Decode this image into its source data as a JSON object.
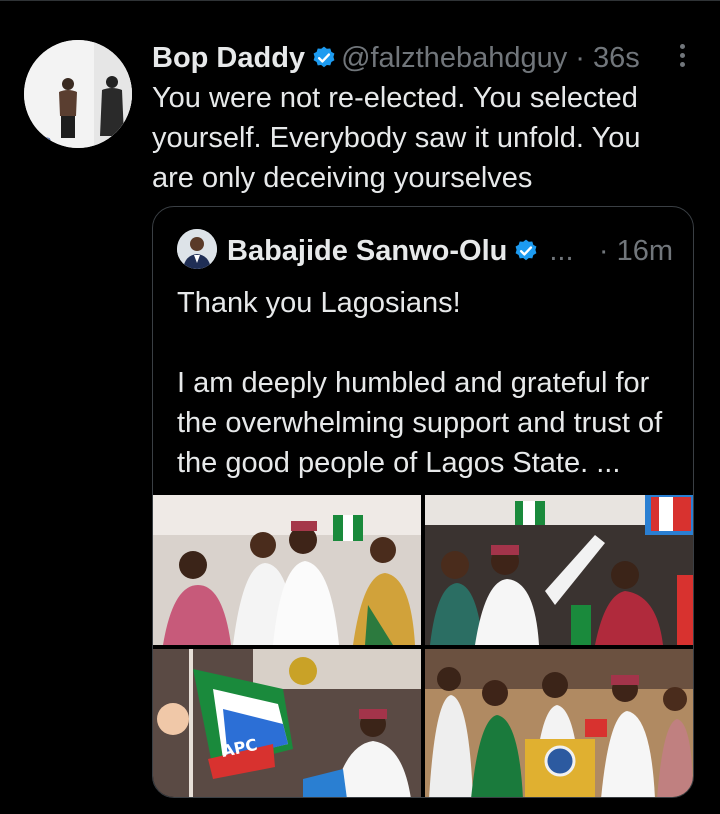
{
  "tweet": {
    "author_name": "Bop Daddy",
    "handle": "@falzthebahdguy",
    "separator": "·",
    "time": "36s",
    "text": "You were not re-elected. You selected yourself. Everybody saw it unfold. You are only deceiving yourselves"
  },
  "quoted": {
    "author_name": "Babajide Sanwo-Olu",
    "ellipsis": "...",
    "time": "· 16m",
    "text": "Thank you Lagosians!\n\nI am deeply humbled and grateful for the overwhelming support and trust of the good people of Lagos State. ...",
    "flag_text": "APC",
    "media_count": 4
  },
  "colors": {
    "background": "#000000",
    "text": "#e7e9ea",
    "secondary": "#71767b",
    "verified": "#1d9bf0",
    "border": "#3a3f44"
  },
  "icons": [
    "verified-badge-icon",
    "more-options-icon"
  ]
}
